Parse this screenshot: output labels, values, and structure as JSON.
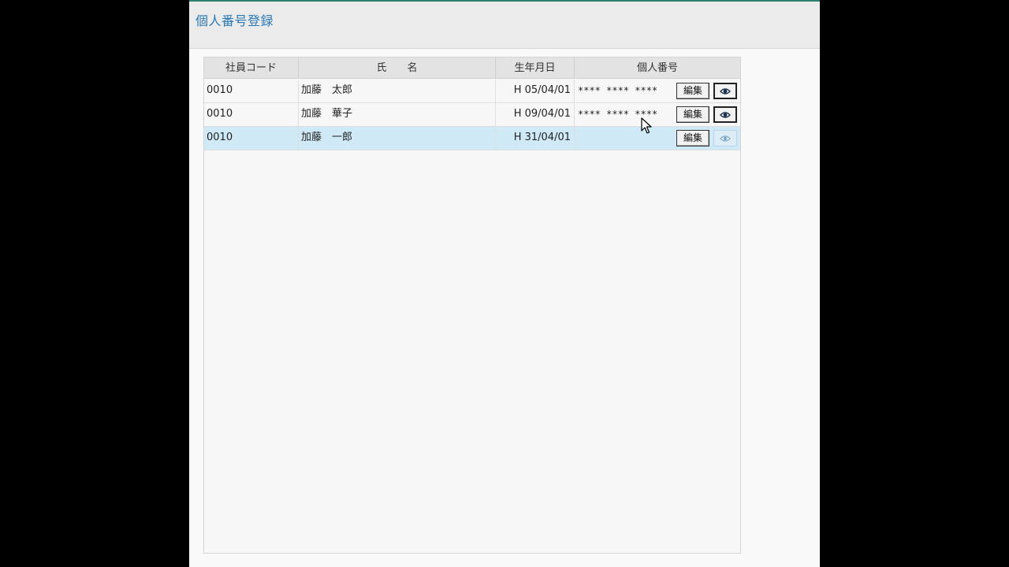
{
  "app": {
    "title": "個人番号登録"
  },
  "columns": {
    "code": "社員コード",
    "name": "氏　　名",
    "birth": "生年月日",
    "number": "個人番号"
  },
  "rows": [
    {
      "code": "0010",
      "name": "加藤　太郎",
      "birth": "H 05/04/01",
      "number": "**** **** ****",
      "edit_label": "編集",
      "eye_enabled": true,
      "selected": false
    },
    {
      "code": "0010",
      "name": "加藤　華子",
      "birth": "H 09/04/01",
      "number": "**** **** ****",
      "edit_label": "編集",
      "eye_enabled": true,
      "selected": false
    },
    {
      "code": "0010",
      "name": "加藤　一郎",
      "birth": "H 31/04/01",
      "number": "",
      "edit_label": "編集",
      "eye_enabled": false,
      "selected": true
    }
  ],
  "icons": {
    "view": "eye-icon",
    "cursor": "mouse-pointer-icon"
  },
  "colors": {
    "title": "#2a78b6",
    "selected_row": "#cfe9f7",
    "header_bg": "#e3e3e3"
  }
}
